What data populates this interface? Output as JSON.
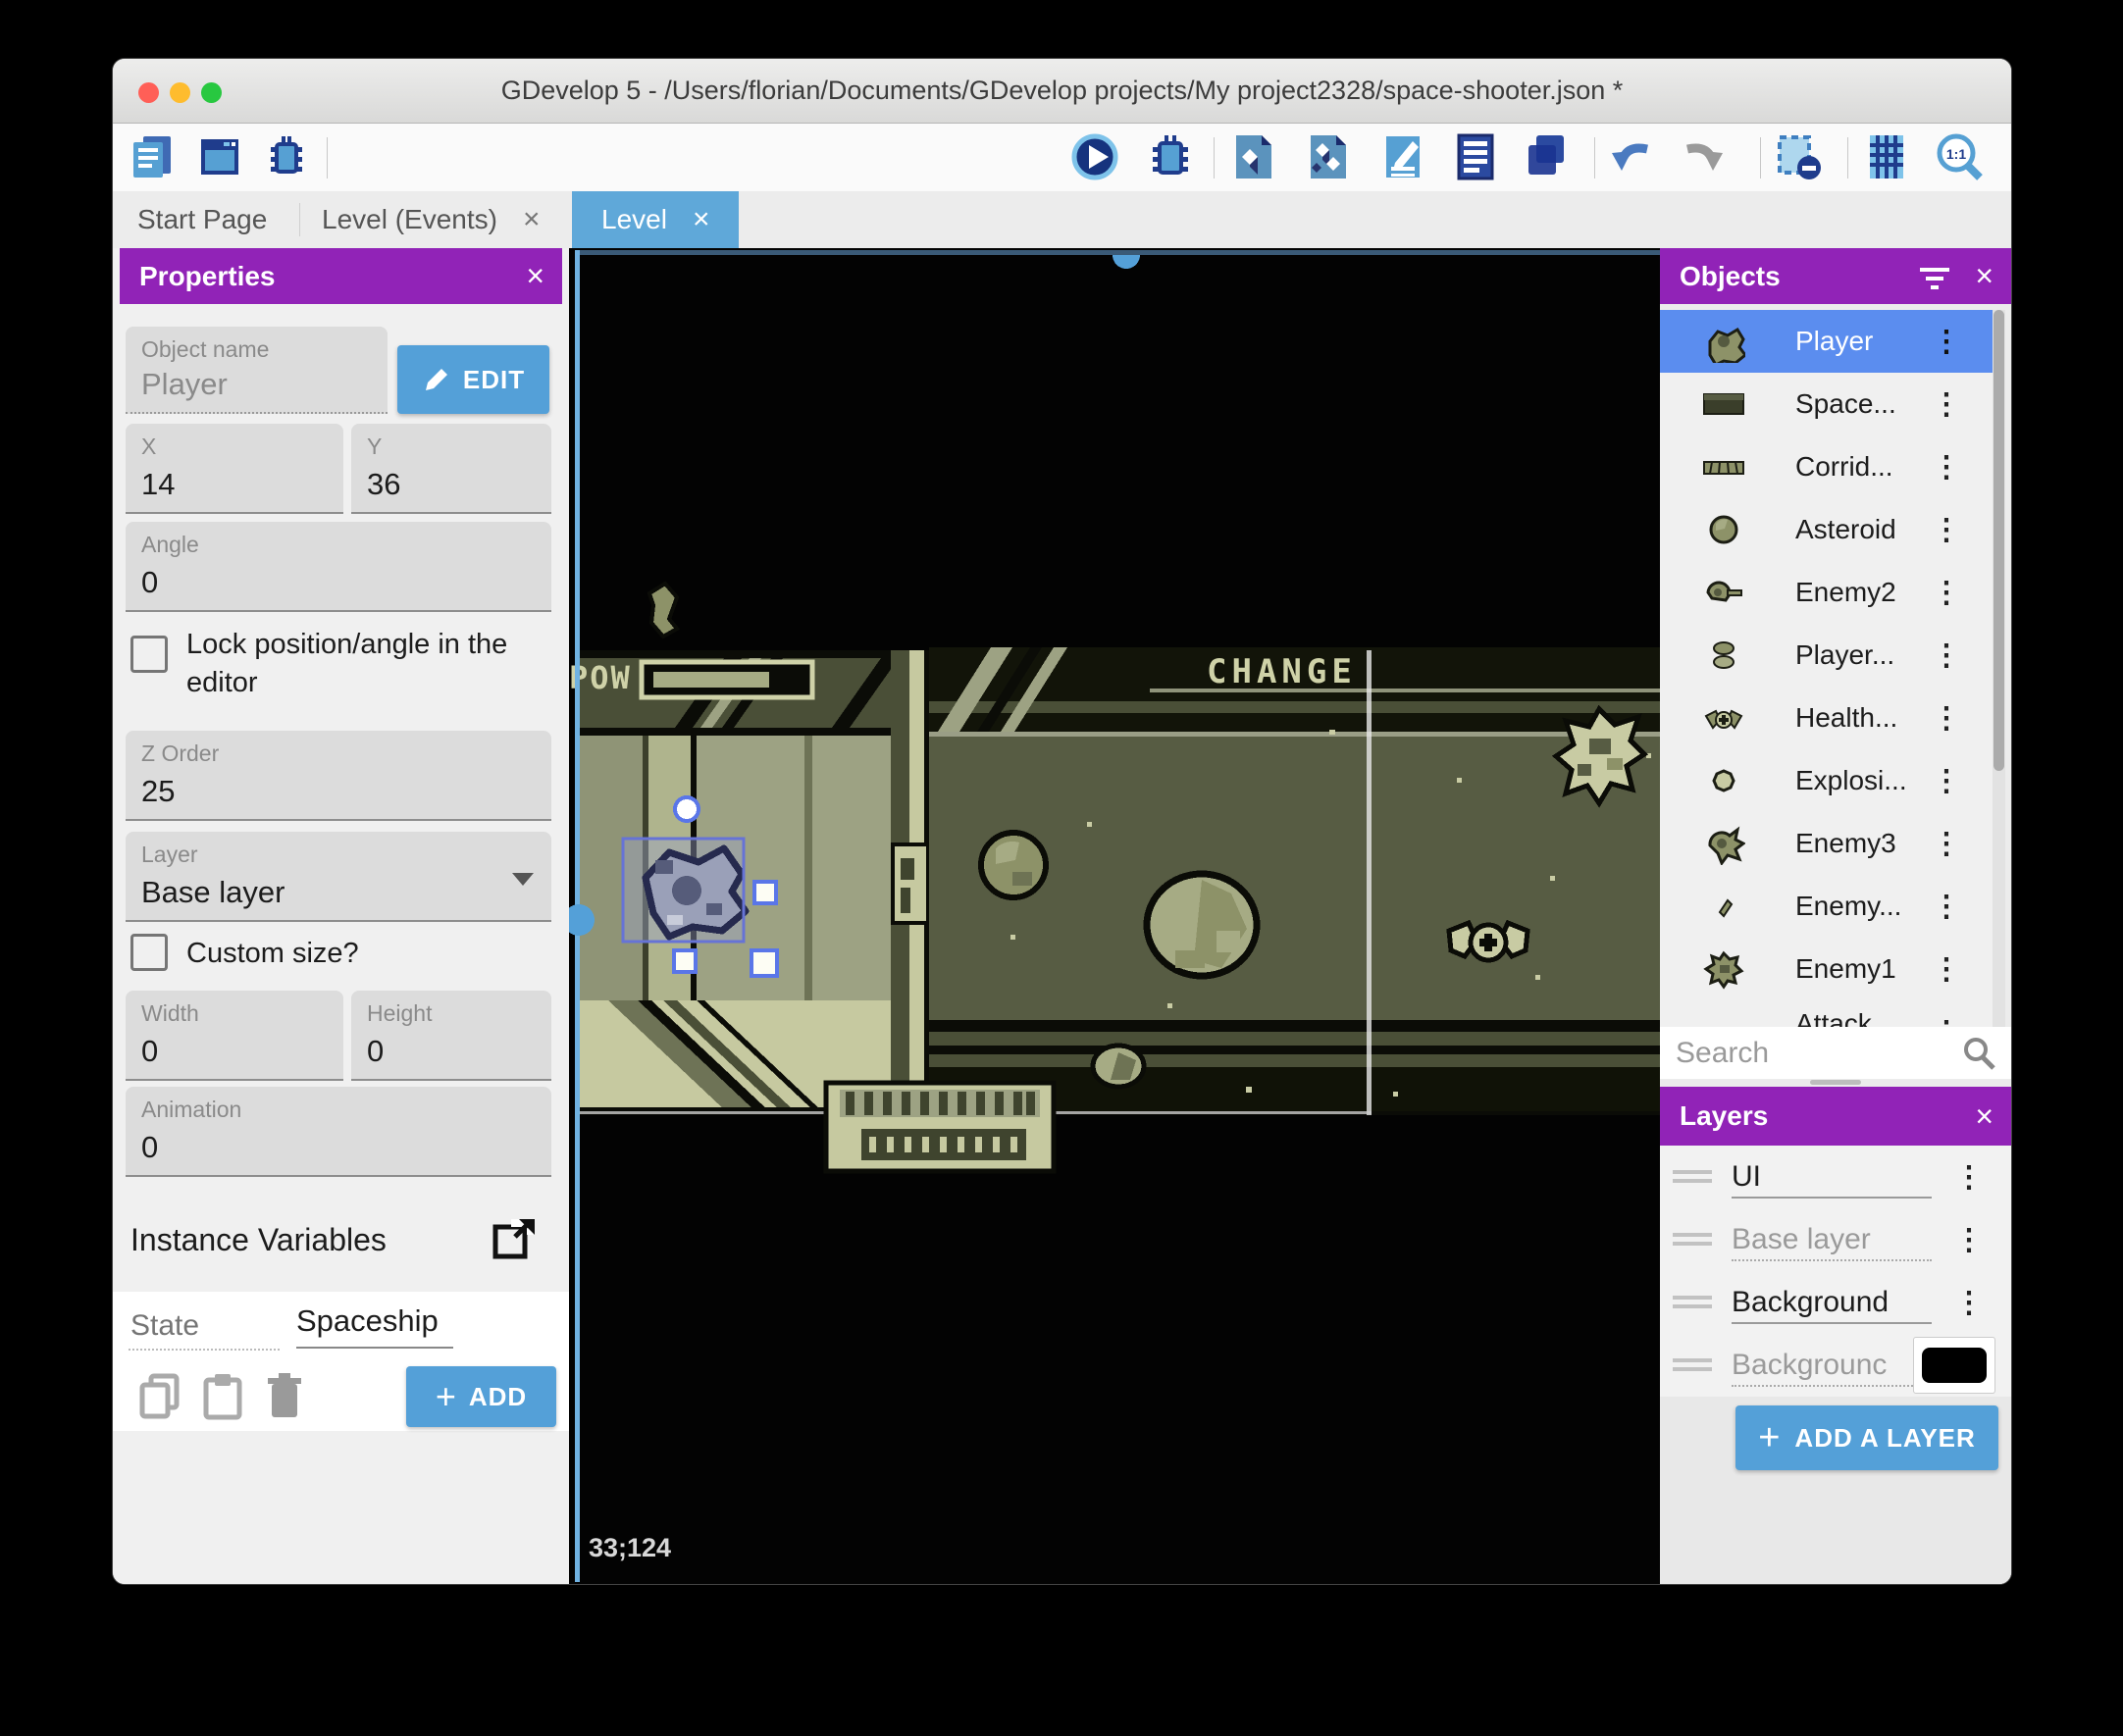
{
  "titlebar": {
    "title": "GDevelop 5 - /Users/florian/Documents/GDevelop projects/My project2328/space-shooter.json *"
  },
  "tabs": [
    {
      "label": "Start Page",
      "closable": false,
      "active": false
    },
    {
      "label": "Level (Events)",
      "closable": true,
      "active": false
    },
    {
      "label": "Level",
      "closable": true,
      "active": true
    }
  ],
  "toolbar": {
    "left_icons": [
      "project-manager-icon",
      "window-icon",
      "debugger-icon"
    ],
    "right_icons": [
      "play-icon",
      "debug-icon",
      "objects-editor-icon",
      "object-groups-icon",
      "properties-icon",
      "instances-list-icon",
      "layers-icon",
      "undo-icon",
      "redo-icon",
      "window-mask-icon",
      "grid-icon",
      "zoom-1-1-icon"
    ]
  },
  "properties": {
    "title": "Properties",
    "close_icon": "×",
    "fields": {
      "object_name": {
        "label": "Object name",
        "value": "Player"
      },
      "x": {
        "label": "X",
        "value": "14"
      },
      "y": {
        "label": "Y",
        "value": "36"
      },
      "angle": {
        "label": "Angle",
        "value": "0"
      },
      "z_order": {
        "label": "Z Order",
        "value": "25"
      },
      "layer": {
        "label": "Layer",
        "value": "Base layer"
      },
      "width": {
        "label": "Width",
        "value": "0"
      },
      "height": {
        "label": "Height",
        "value": "0"
      },
      "animation": {
        "label": "Animation",
        "value": "0"
      }
    },
    "edit_button": "EDIT",
    "lock_checkbox_label": "Lock position/angle in the editor",
    "custom_size_label": "Custom size?",
    "instance_variables_title": "Instance Variables",
    "variable_name_placeholder": "State",
    "variable_value": "Spaceship",
    "add_button": "ADD"
  },
  "objects_panel": {
    "title": "Objects",
    "search_placeholder": "Search",
    "items": [
      {
        "label": "Player",
        "selected": true,
        "icon": "player-ship"
      },
      {
        "label": "Space...",
        "selected": false,
        "icon": "space-background"
      },
      {
        "label": "Corrid...",
        "selected": false,
        "icon": "corridor"
      },
      {
        "label": "Asteroid",
        "selected": false,
        "icon": "asteroid"
      },
      {
        "label": "Enemy2",
        "selected": false,
        "icon": "enemy2"
      },
      {
        "label": "Player...",
        "selected": false,
        "icon": "player-bullet"
      },
      {
        "label": "Health...",
        "selected": false,
        "icon": "health-pickup"
      },
      {
        "label": "Explosi...",
        "selected": false,
        "icon": "explosion"
      },
      {
        "label": "Enemy3",
        "selected": false,
        "icon": "enemy3"
      },
      {
        "label": "Enemy...",
        "selected": false,
        "icon": "enemy-bullet"
      },
      {
        "label": "Enemy1",
        "selected": false,
        "icon": "enemy1"
      },
      {
        "label": "Attack...",
        "selected": false,
        "icon": "attack",
        "partially_visible": true
      }
    ]
  },
  "layers_panel": {
    "title": "Layers",
    "close_icon": "×",
    "rows": [
      {
        "name": "UI",
        "muted": false,
        "swatch": false
      },
      {
        "name": "Base layer",
        "muted": true,
        "swatch": false
      },
      {
        "name": "Background",
        "muted": false,
        "swatch": false
      },
      {
        "name": "Backgrounc",
        "muted": true,
        "swatch": true,
        "swatch_color": "#000000"
      }
    ],
    "add_button": "ADD A LAYER"
  },
  "scene": {
    "hud_pow": "POW",
    "hud_change": "CHANGE",
    "cursor_coordinates": "33;124",
    "selected_instance": "Player"
  },
  "colors": {
    "panel_purple": "#9123b7",
    "accent_blue": "#54a0d8",
    "selected_row_blue": "#5b8def",
    "active_tab_blue": "#5fa8d9",
    "scene_olive_dark": "#4a4f37",
    "scene_olive": "#575c43",
    "scene_wall": "#9da283",
    "scene_pale": "#c6c9a0"
  }
}
